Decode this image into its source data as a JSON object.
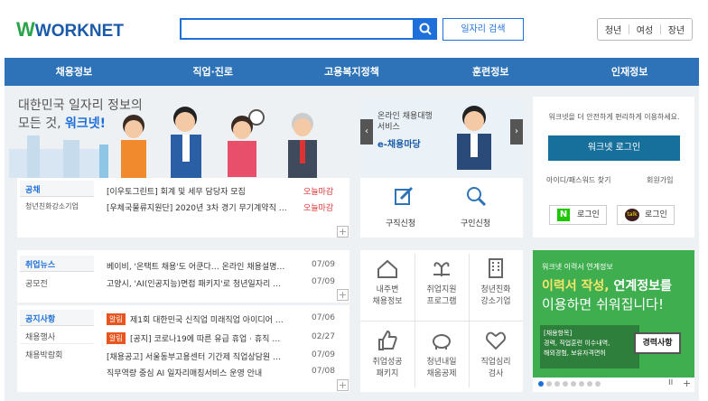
{
  "header": {
    "logo_text": "WORKNET",
    "search_placeholder": "",
    "search_button": "일자리 검색",
    "audience": [
      "청년",
      "여성",
      "장년"
    ]
  },
  "nav": [
    "채용정보",
    "직업·진로",
    "고용복지정책",
    "훈련정보",
    "인재정보"
  ],
  "hero": {
    "line1": "대한민국 일자리 정보의",
    "line2a": "모든 것, ",
    "line2b": "워크넷!"
  },
  "notice_box": {
    "tab1": "공채",
    "tab2": "청년친화강소기업",
    "rows": [
      {
        "title": "[이우토그린트] 회계 및 세무 담당자 모집",
        "status": "오늘마감"
      },
      {
        "title": "[우체국물류지원단] 2020년 3차 경기 무기계약직 …",
        "status": "오늘마감"
      }
    ]
  },
  "banner_center": {
    "line1": "온라인 채용대행",
    "line2": "서비스",
    "brand": "e-채용마당"
  },
  "apply_box": {
    "item1": "구직신청",
    "item2": "구인신청"
  },
  "login_box": {
    "desc": "워크넷을 더 안전하게 편리하게 이용하세요.",
    "login_button": "워크넷 로그인",
    "find": "아이디/패스워드 찾기",
    "join": "회원가입",
    "naver": "로그인",
    "kakao": "로그인"
  },
  "news_box": {
    "tab1": "취업뉴스",
    "tab2": "공모전",
    "rows": [
      {
        "title": "베이비, '온택트 채용'도 어쿤다… 온라인 채용설명…",
        "date": "07/09"
      },
      {
        "title": "고양시, 'AI(인공지능)면접 패키지'로 청년일자리 …",
        "date": "07/09"
      }
    ]
  },
  "notice2_box": {
    "tab1": "공지사항",
    "tab2": "채용행사",
    "tab3": "채용박람회",
    "rows": [
      {
        "badge": "알림",
        "title": "제1회 대한민국 신직업 미래직업 아이디어 …",
        "date": "07/06"
      },
      {
        "badge": "알림",
        "title": "[공지] 코로나19에 따른 유급 휴업 · 휴직 …",
        "date": "02/27"
      },
      {
        "badge": "",
        "title": "[채용공고] 서울동부고용센터 기간제 직업상담원 …",
        "date": "07/09"
      },
      {
        "badge": "",
        "title": "직무역량 중심 AI 일자리매칭서비스 운영 안내",
        "date": "07/08"
      }
    ]
  },
  "services": [
    {
      "l1": "내주변",
      "l2": "채용정보"
    },
    {
      "l1": "취업지원",
      "l2": "프로그램"
    },
    {
      "l1": "청년친화",
      "l2": "강소기업"
    },
    {
      "l1": "취업성공",
      "l2": "패키지"
    },
    {
      "l1": "청년내일",
      "l2": "채움공제"
    },
    {
      "l1": "직업심리",
      "l2": "검사"
    }
  ],
  "green_banner": {
    "small": "워크넷 이력서 연계정보",
    "big1a": "이력서 작성, ",
    "big1b": "연계정보",
    "big1c": "를",
    "big2": "이용하면 쉬워집니다!",
    "box1": "[채용항목]",
    "box2": "경력, 직업훈련 이수내역,",
    "box3": "해외경험, 보유자격면허",
    "card": "경력사항"
  },
  "colors": {
    "brand_blue": "#1e6fd9",
    "nav_blue": "#2e73b8",
    "green": "#3fae4f",
    "red": "#d33"
  }
}
